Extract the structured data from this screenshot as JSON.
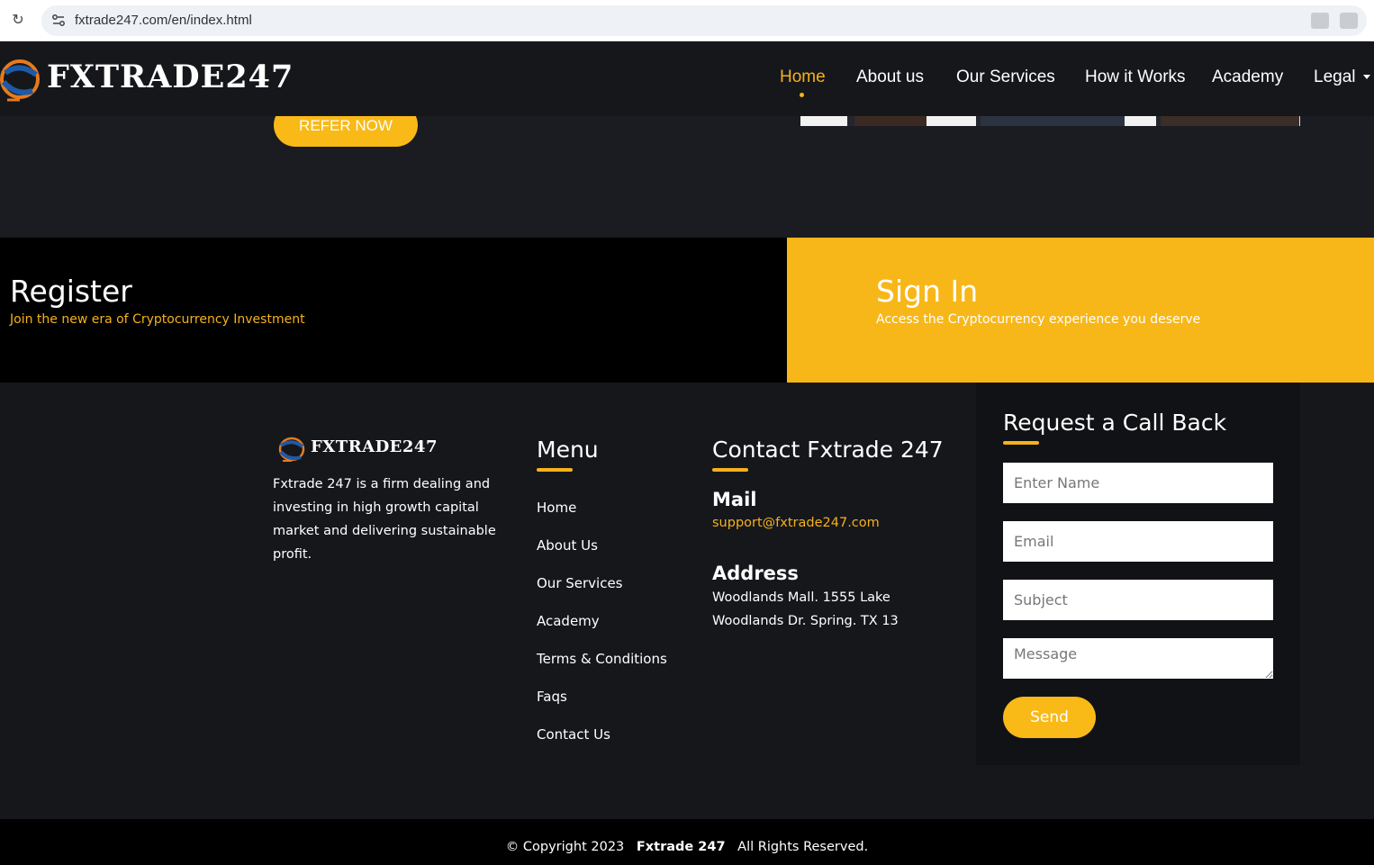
{
  "browser": {
    "url": "fxtrade247.com/en/index.html"
  },
  "header": {
    "logo_text": "FXTRADE247",
    "nav": [
      {
        "label": "Home"
      },
      {
        "label": "About us"
      },
      {
        "label": "Our Services"
      },
      {
        "label": "How it Works"
      },
      {
        "label": "Academy"
      },
      {
        "label": "Legal"
      }
    ]
  },
  "top_section": {
    "refer_label": "REFER NOW"
  },
  "register": {
    "title": "Register",
    "subtitle": "Join the new era of Cryptocurrency Investment"
  },
  "signin": {
    "title": "Sign In",
    "subtitle": "Access the Cryptocurrency experience you deserve"
  },
  "footer": {
    "logo_text": "FXTRADE247",
    "about": "Fxtrade 247 is a firm dealing and investing in high growth capital market and delivering sustainable profit.",
    "menu_heading": "Menu",
    "menu": [
      "Home",
      "About Us",
      "Our Services",
      "Academy",
      "Terms & Conditions",
      "Faqs",
      "Contact Us"
    ],
    "contact_heading": "Contact Fxtrade 247",
    "mail_label": "Mail",
    "mail": "support@fxtrade247.com",
    "address_label": "Address",
    "address": "Woodlands Mall. 1555 Lake Woodlands Dr. Spring. TX 13",
    "callback": {
      "title": "Request a Call Back",
      "name_placeholder": "Enter Name",
      "email_placeholder": "Email",
      "subject_placeholder": "Subject",
      "message_placeholder": "Message",
      "send_label": "Send"
    }
  },
  "copyright": {
    "prefix": "© Copyright 2023",
    "brand": "Fxtrade 247",
    "suffix": "All Rights Reserved."
  },
  "colors": {
    "accent": "#f8b719",
    "background": "#16171b",
    "black": "#000000"
  }
}
